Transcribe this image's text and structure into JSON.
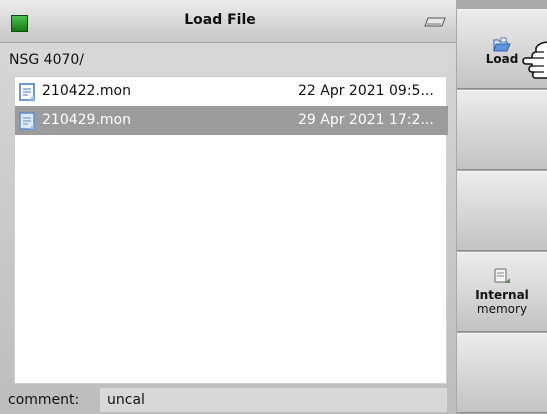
{
  "window": {
    "title": "Load File"
  },
  "path": "NSG 4070/",
  "files": [
    {
      "name": "210422.mon",
      "date": "22 Apr 2021 09:5...",
      "selected": false
    },
    {
      "name": "210429.mon",
      "date": "29 Apr 2021 17:2...",
      "selected": true
    }
  ],
  "comment": {
    "label": "comment:",
    "value": "uncal"
  },
  "softkeys": {
    "load": {
      "label": "Load",
      "icon": "open-folder-icon"
    },
    "storage": {
      "label_line1": "Internal",
      "label_line2": "memory",
      "icon": "memory-storage-icon"
    }
  },
  "colors": {
    "status_led": "#2e9e2e",
    "selection": "#9c9c9c",
    "list_background": "#ffffff",
    "panel_gray": "#d8d8d8"
  }
}
